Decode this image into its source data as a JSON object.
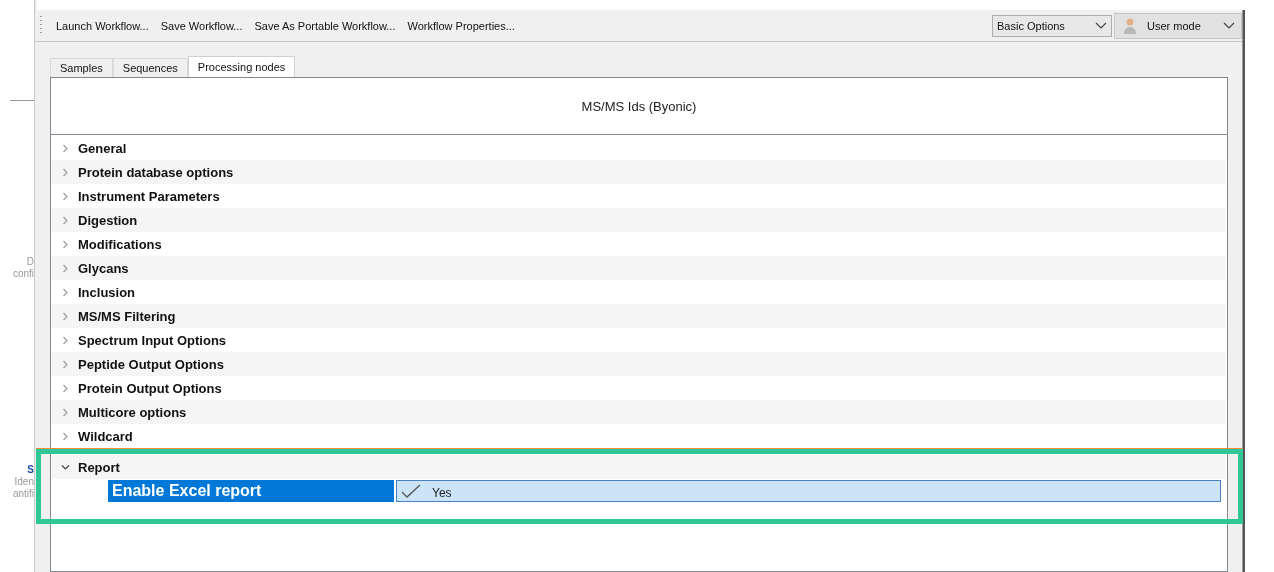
{
  "background_window": {
    "texts": [
      "D",
      "confi",
      "S",
      "Iden",
      "antifi"
    ]
  },
  "toolbar": {
    "buttons": [
      "Launch Workflow...",
      "Save Workflow...",
      "Save As Portable Workflow...",
      "Workflow Properties..."
    ],
    "options_dropdown": {
      "value": "Basic Options"
    },
    "mode_dropdown": {
      "value": "User mode"
    }
  },
  "tabs": [
    {
      "label": "Samples",
      "selected": false
    },
    {
      "label": "Sequences",
      "selected": false
    },
    {
      "label": "Processing nodes",
      "selected": true
    }
  ],
  "panel": {
    "title": "MS/MS Ids (Byonic)",
    "groups": [
      {
        "label": "General",
        "expanded": false
      },
      {
        "label": "Protein database options",
        "expanded": false
      },
      {
        "label": "Instrument Parameters",
        "expanded": false
      },
      {
        "label": "Digestion",
        "expanded": false
      },
      {
        "label": "Modifications",
        "expanded": false
      },
      {
        "label": "Glycans",
        "expanded": false
      },
      {
        "label": "Inclusion",
        "expanded": false
      },
      {
        "label": "MS/MS Filtering",
        "expanded": false
      },
      {
        "label": "Spectrum Input Options",
        "expanded": false
      },
      {
        "label": "Peptide Output Options",
        "expanded": false
      },
      {
        "label": "Protein Output Options",
        "expanded": false
      },
      {
        "label": "Multicore options",
        "expanded": false
      },
      {
        "label": "Wildcard",
        "expanded": false
      },
      {
        "label": "Report",
        "expanded": true,
        "children": [
          {
            "name": "Enable Excel report",
            "value": "Yes",
            "checked": true,
            "selected": true
          }
        ]
      }
    ]
  }
}
